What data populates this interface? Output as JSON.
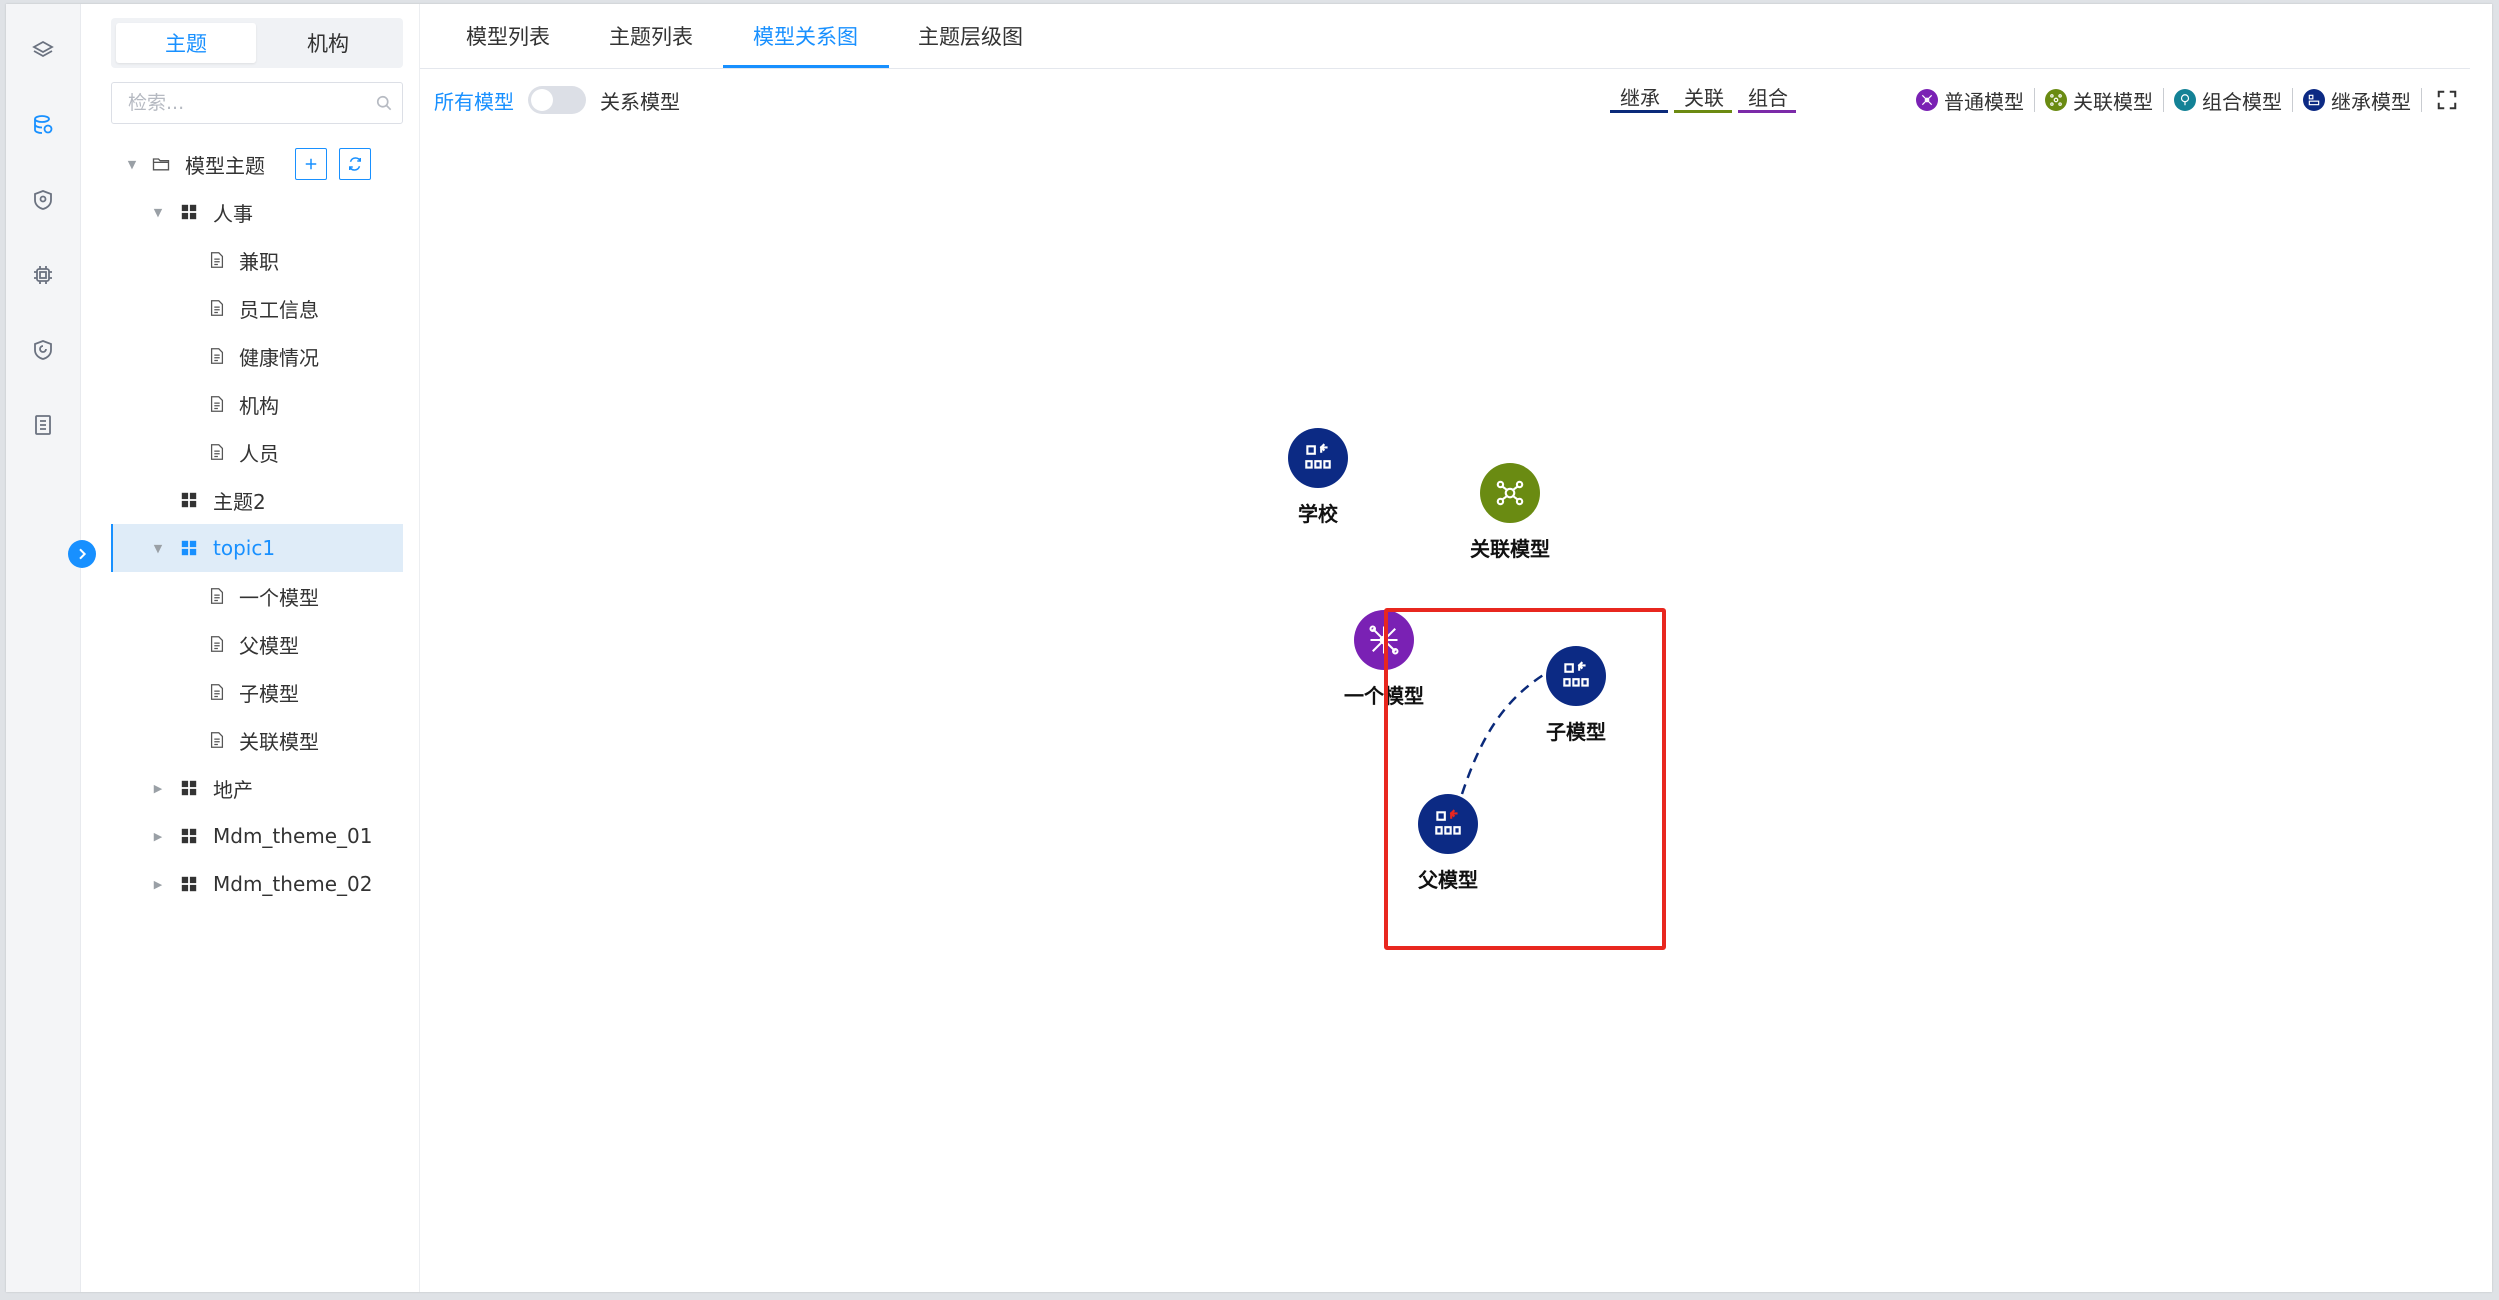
{
  "sidebar_rail": {
    "icons": [
      "layers-icon",
      "database-icon",
      "shield-pin-icon",
      "chip-icon",
      "security-shield-icon",
      "document-list-icon"
    ]
  },
  "tree_panel": {
    "tabs": [
      "主题",
      "机构"
    ],
    "active_tab": "主题",
    "search_placeholder": "检索...",
    "root_label": "模型主题",
    "items": [
      {
        "label": "人事",
        "type": "topic",
        "expanded": true
      },
      {
        "label": "兼职",
        "type": "model"
      },
      {
        "label": "员工信息",
        "type": "model"
      },
      {
        "label": "健康情况",
        "type": "model"
      },
      {
        "label": "机构",
        "type": "model"
      },
      {
        "label": "人员",
        "type": "model"
      },
      {
        "label": "主题2",
        "type": "topic"
      },
      {
        "label": "topic1",
        "type": "topic",
        "expanded": true,
        "selected": true
      },
      {
        "label": "一个模型",
        "type": "model"
      },
      {
        "label": "父模型",
        "type": "model"
      },
      {
        "label": "子模型",
        "type": "model"
      },
      {
        "label": "关联模型",
        "type": "model"
      },
      {
        "label": "地产",
        "type": "topic",
        "collapsed": true
      },
      {
        "label": "Mdm_theme_01",
        "type": "topic",
        "collapsed": true
      },
      {
        "label": "Mdm_theme_02",
        "type": "topic",
        "collapsed": true
      }
    ]
  },
  "main_tabs": [
    "模型列表",
    "主题列表",
    "模型关系图",
    "主题层级图"
  ],
  "active_main_tab": "模型关系图",
  "toolbar": {
    "all_models_label": "所有模型",
    "relation_models_label": "关系模型",
    "switch_on": false
  },
  "line_legend": [
    {
      "label": "继承",
      "color": "#0b2a7a"
    },
    {
      "label": "关联",
      "color": "#6c8a12"
    },
    {
      "label": "组合",
      "color": "#7b2aa8"
    }
  ],
  "node_legend": [
    {
      "label": "普通模型",
      "color": "#7a21b4",
      "icon": "network-icon"
    },
    {
      "label": "关联模型",
      "color": "#6a8b12",
      "icon": "molecule-icon"
    },
    {
      "label": "组合模型",
      "color": "#138296",
      "icon": "tree-icon"
    },
    {
      "label": "继承模型",
      "color": "#0c2a84",
      "icon": "inherit-icon"
    }
  ],
  "graph": {
    "nodes": [
      {
        "id": "school",
        "label": "学校",
        "kind": "继承模型",
        "color": "#0c2a84"
      },
      {
        "id": "assoc",
        "label": "关联模型",
        "kind": "关联模型",
        "color": "#6a8b12"
      },
      {
        "id": "one",
        "label": "一个模型",
        "kind": "普通模型",
        "color": "#7a21b4"
      },
      {
        "id": "child",
        "label": "子模型",
        "kind": "继承模型",
        "color": "#0c2a84"
      },
      {
        "id": "parent",
        "label": "父模型",
        "kind": "继承模型",
        "color": "#0c2a84"
      }
    ],
    "edges": [
      {
        "from": "parent",
        "to": "child",
        "type": "继承",
        "style": "dashed"
      }
    ],
    "highlight_color": "#e8271f"
  }
}
